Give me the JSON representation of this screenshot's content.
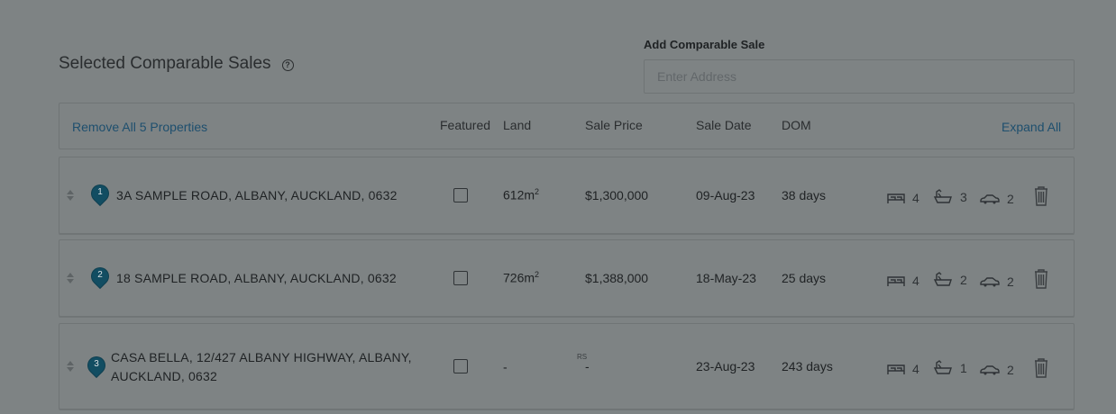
{
  "page": {
    "title": "Selected Comparable Sales",
    "add_label": "Add Comparable Sale",
    "add_placeholder": "Enter Address"
  },
  "header": {
    "remove_all": "Remove All 5 Properties",
    "expand_all": "Expand All",
    "columns": {
      "featured": "Featured",
      "land": "Land",
      "sale_price": "Sale Price",
      "sale_date": "Sale Date",
      "dom": "DOM"
    }
  },
  "rows": [
    {
      "num": "1",
      "address_line1": "3A SAMPLE ROAD, ALBANY, AUCKLAND, 0632",
      "address_line2": "",
      "land": "612m",
      "land_sup": "2",
      "price_prefix": "",
      "price": "$1,300,000",
      "date": "09-Aug-23",
      "dom": "38 days",
      "beds": "4",
      "baths": "3",
      "cars": "2"
    },
    {
      "num": "2",
      "address_line1": "18 SAMPLE ROAD, ALBANY, AUCKLAND, 0632",
      "address_line2": "",
      "land": "726m",
      "land_sup": "2",
      "price_prefix": "",
      "price": "$1,388,000",
      "date": "18-May-23",
      "dom": "25 days",
      "beds": "4",
      "baths": "2",
      "cars": "2"
    },
    {
      "num": "3",
      "address_line1": "CASA BELLA, 12/427 ALBANY HIGHWAY, ALBANY,",
      "address_line2": "AUCKLAND, 0632",
      "land": "-",
      "land_sup": "",
      "price_prefix": "RS",
      "price": "-",
      "date": "23-Aug-23",
      "dom": "243 days",
      "beds": "4",
      "baths": "1",
      "cars": "2"
    }
  ],
  "icons": {
    "help": "question-circle-icon",
    "drag": "drag-handle-icon",
    "pin": "map-pin-icon",
    "bed": "bed-icon",
    "bath": "bath-icon",
    "car": "car-icon",
    "trash": "trash-icon"
  },
  "colors": {
    "overlay_bg": "#7e8384",
    "link": "#1e4f6e",
    "pin": "#124d62"
  }
}
